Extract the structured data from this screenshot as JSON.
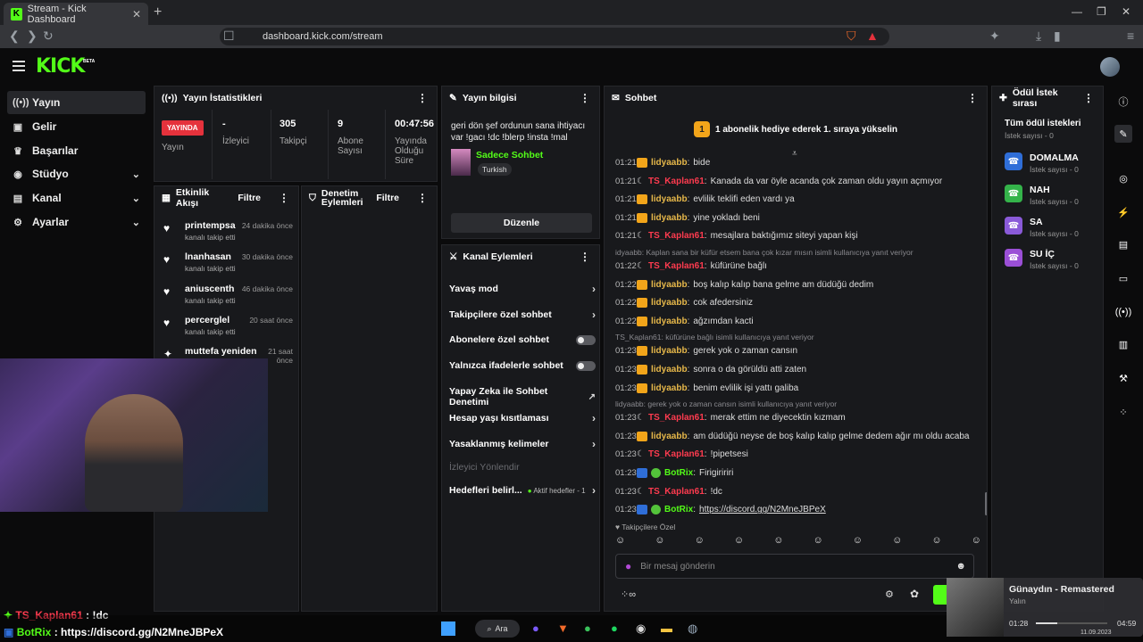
{
  "browser": {
    "tab_title": "Stream - Kick Dashboard",
    "url": "dashboard.kick.com/stream"
  },
  "app": {
    "logo": "KICK",
    "logo_badge": "BETA"
  },
  "sidebar": {
    "items": [
      {
        "label": "Yayın",
        "icon": "broadcast-icon"
      },
      {
        "label": "Gelir",
        "icon": "wallet-icon"
      },
      {
        "label": "Başarılar",
        "icon": "trophy-icon"
      },
      {
        "label": "Stüdyo",
        "icon": "studio-icon"
      },
      {
        "label": "Kanal",
        "icon": "user-icon"
      },
      {
        "label": "Ayarlar",
        "icon": "gear-icon"
      }
    ]
  },
  "stats": {
    "title": "Yayın İstatistikleri",
    "live_badge": "YAYINDA",
    "live_label": "Yayın",
    "viewers_value": "-",
    "viewers_label": "İzleyici",
    "followers_value": "305",
    "followers_label": "Takipçi",
    "subs_value": "9",
    "subs_label": "Abone Sayısı",
    "duration_value": "00:47:56",
    "duration_label": "Yayında Olduğu Süre"
  },
  "activity": {
    "title": "Etkinlik Akışı",
    "filter": "Filtre",
    "items": [
      {
        "name": "printempsa",
        "time": "24 dakika önce",
        "sub": "kanalı takip etti"
      },
      {
        "name": "lnanhasan",
        "time": "30 dakika önce",
        "sub": "kanalı takip etti"
      },
      {
        "name": "aniuscenth",
        "time": "46 dakika önce",
        "sub": "kanalı takip etti"
      },
      {
        "name": "percerglel",
        "time": "20 saat önce",
        "sub": "kanalı takip etti"
      },
      {
        "name": "muttefa yeniden",
        "time": "21 saat önce",
        "sub": ""
      }
    ]
  },
  "moderation": {
    "title": "Denetim Eylemleri",
    "filter": "Filtre"
  },
  "stream_info": {
    "title": "Yayın bilgisi",
    "stream_title": "geri dön şef ordunun sana ihtiyacı var !gacı !dc !blerp !insta !mal",
    "category": "Sadece Sohbet",
    "language_tag": "Turkish",
    "edit_button": "Düzenle"
  },
  "channel_actions": {
    "title": "Kanal Eylemleri",
    "items": [
      {
        "label": "Yavaş mod",
        "control": "chevron"
      },
      {
        "label": "Takipçilere özel sohbet",
        "control": "chevron"
      },
      {
        "label": "Abonelere özel sohbet",
        "control": "toggle"
      },
      {
        "label": "Yalnızca ifadelerle sohbet",
        "control": "toggle"
      },
      {
        "label": "Yapay Zeka ile Sohbet Denetimi",
        "control": "external"
      },
      {
        "label": "Hesap yaşı kısıtlaması",
        "control": "chevron"
      },
      {
        "label": "Yasaklanmış kelimeler",
        "control": "chevron"
      },
      {
        "label": "İzleyici Yönlendir",
        "control": "none"
      },
      {
        "label": "Hedefleri belirl...",
        "control": "chevron",
        "extra": "Aktif hedefler - 1"
      }
    ]
  },
  "chat": {
    "title": "Sohbet",
    "pinned": "1 abonelik hediye ederek 1. sıraya yükselin",
    "pinned_rank": "1",
    "followers_only": "Takipçilere Özel",
    "input_placeholder": "Bir mesaj gönderin",
    "messages": [
      {
        "time": "01:21",
        "badge": "crown",
        "user": "lidyaabb",
        "ucls": "u1",
        "text": "bide"
      },
      {
        "time": "01:21",
        "badge": "moon",
        "user": "TS_Kaplan61",
        "ucls": "u2",
        "text": "Kanada da var öyle acanda çok zaman oldu yayın açmıyor"
      },
      {
        "time": "01:21",
        "badge": "crown",
        "user": "lidyaabb",
        "ucls": "u1",
        "text": "evlilik teklifi eden vardı ya"
      },
      {
        "time": "01:21",
        "badge": "crown",
        "user": "lidyaabb",
        "ucls": "u1",
        "text": "yine yokladı beni"
      },
      {
        "time": "01:21",
        "badge": "moon",
        "user": "TS_Kaplan61",
        "ucls": "u2",
        "text": "mesajlara baktığımız siteyi yapan kişi"
      },
      {
        "reply": "idyaabb: Kaplan sana bir küfür etsem bana çok kızar mısın isimli kullanıcıya yanıt veriyor"
      },
      {
        "time": "01:22",
        "badge": "moon",
        "user": "TS_Kaplan61",
        "ucls": "u2",
        "text": "küfürüne bağlı"
      },
      {
        "time": "01:22",
        "badge": "crown",
        "user": "lidyaabb",
        "ucls": "u1",
        "text": "boş kalıp kalıp bana gelme am düdüğü dedim"
      },
      {
        "time": "01:22",
        "badge": "crown",
        "user": "lidyaabb",
        "ucls": "u1",
        "text": "cok afedersiniz"
      },
      {
        "time": "01:22",
        "badge": "crown",
        "user": "lidyaabb",
        "ucls": "u1",
        "text": "ağzımdan kacti"
      },
      {
        "reply": "TS_Kaplan61: küfürüne bağlı isimli kullanıcıya yanıt veriyor"
      },
      {
        "time": "01:23",
        "badge": "crown",
        "user": "lidyaabb",
        "ucls": "u1",
        "text": "gerek yok o zaman cansın"
      },
      {
        "time": "01:23",
        "badge": "crown",
        "user": "lidyaabb",
        "ucls": "u1",
        "text": "sonra o da görüldü atti zaten"
      },
      {
        "time": "01:23",
        "badge": "crown",
        "user": "lidyaabb",
        "ucls": "u1",
        "text": "benim evlilik işi yattı galiba"
      },
      {
        "reply": "lidyaabb: gerek yok o zaman cansın    isimli kullanıcıya yanıt veriyor"
      },
      {
        "time": "01:23",
        "badge": "moon",
        "user": "TS_Kaplan61",
        "ucls": "u2",
        "text": "merak ettim ne diyecektin kızmam"
      },
      {
        "time": "01:23",
        "badge": "crown",
        "user": "lidyaabb",
        "ucls": "u1",
        "text": "am düdüğü neyse de boş kalıp kalıp gelme dedem ağır mı oldu acaba"
      },
      {
        "time": "01:23",
        "badge": "moon",
        "user": "TS_Kaplan61",
        "ucls": "u2",
        "text": "!pipetsesi"
      },
      {
        "time": "01:23",
        "badge": "bot",
        "user": "BotRix",
        "ucls": "u3",
        "text": "Firigiririri"
      },
      {
        "time": "01:23",
        "badge": "moon",
        "user": "TS_Kaplan61",
        "ucls": "u2",
        "text": "!dc"
      },
      {
        "time": "01:23",
        "badge": "bot",
        "user": "BotRix",
        "ucls": "u3",
        "text": "https://discord.gg/N2MneJBPeX"
      }
    ]
  },
  "rewards": {
    "title": "Ödül İstek sırası",
    "all_title": "Tüm ödül istekleri",
    "all_sub": "İstek sayısı - 0",
    "items": [
      {
        "name": "DOMALMA",
        "sub": "İstek sayısı - 0",
        "color": "#2f6ed8"
      },
      {
        "name": "NAH",
        "sub": "İstek sayısı - 0",
        "color": "#34b34a"
      },
      {
        "name": "SA",
        "sub": "İstek sayısı - 0",
        "color": "#8a5ad8"
      },
      {
        "name": "SU İÇ",
        "sub": "İstek sayısı - 0",
        "color": "#9b4fd6"
      }
    ]
  },
  "overlay": {
    "line1_user": "TS_Kaplan61",
    "line1_text": ": !dc",
    "line2_user": "BotRix",
    "line2_text": ": https://discord.gg/N2MneJBPeX"
  },
  "taskbar": {
    "search": "Ara"
  },
  "music": {
    "title": "Günaydın - Remastered",
    "artist": "Yalın",
    "elapsed": "01:28",
    "total": "04:59",
    "date": "11.09.2023"
  },
  "colors": {
    "brand": "#53fc18",
    "live": "#e5323c"
  }
}
